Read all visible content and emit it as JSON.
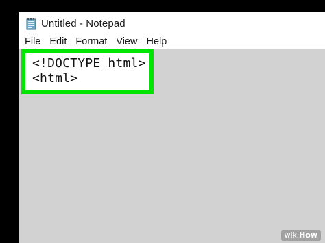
{
  "window": {
    "title": "Untitled - Notepad",
    "icon": "notepad-icon"
  },
  "menubar": {
    "items": [
      {
        "label": "File"
      },
      {
        "label": "Edit"
      },
      {
        "label": "Format"
      },
      {
        "label": "View"
      },
      {
        "label": "Help"
      }
    ]
  },
  "editor": {
    "lines": [
      "<!DOCTYPE html>",
      "<html>"
    ],
    "highlight_color": "#00e600"
  },
  "watermark": {
    "prefix": "wiki",
    "suffix": "How"
  }
}
